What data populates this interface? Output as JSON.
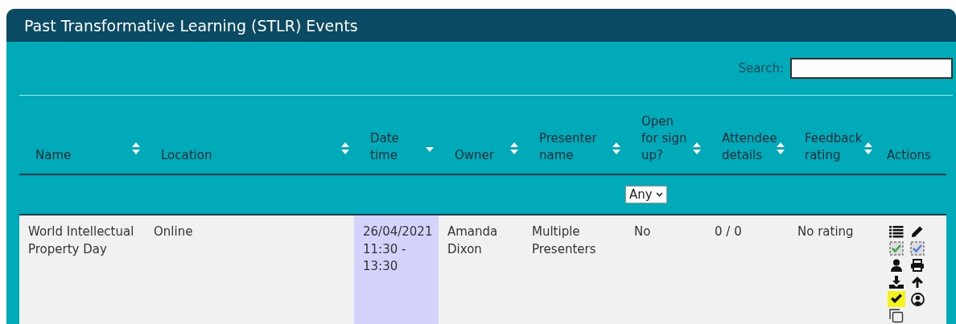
{
  "panel": {
    "title": "Past Transformative Learning (STLR) Events"
  },
  "search": {
    "label": "Search:"
  },
  "table": {
    "columns": [
      {
        "label": "Name",
        "sortable": true,
        "sorted_desc": false
      },
      {
        "label": "Location",
        "sortable": true,
        "sorted_desc": false
      },
      {
        "label": "Date time",
        "sortable": true,
        "sorted_desc": true
      },
      {
        "label": "Owner",
        "sortable": true,
        "sorted_desc": false
      },
      {
        "label": "Presenter name",
        "sortable": true,
        "sorted_desc": false
      },
      {
        "label": "Open for sign up?",
        "sortable": true,
        "sorted_desc": false,
        "filter": "Any"
      },
      {
        "label": "Attendee details",
        "sortable": true,
        "sorted_desc": false
      },
      {
        "label": "Feedback rating",
        "sortable": true,
        "sorted_desc": false
      },
      {
        "label": "Actions",
        "sortable": false,
        "sorted_desc": false
      }
    ],
    "rows": [
      {
        "cells": [
          "World Intellectual Property Day",
          "Online",
          "26/04/2021 11:30 - 13:30",
          "Amanda Dixon",
          "Multiple Presenters",
          "No",
          "0 / 0",
          "No rating"
        ],
        "actions": [
          {
            "kind": "list",
            "highlighted": false
          },
          {
            "kind": "pencil",
            "highlighted": false
          },
          {
            "kind": "check-green",
            "highlighted": false
          },
          {
            "kind": "check-blue",
            "highlighted": false
          },
          {
            "kind": "person",
            "highlighted": false
          },
          {
            "kind": "printer",
            "highlighted": false
          },
          {
            "kind": "download",
            "highlighted": false
          },
          {
            "kind": "arrow-up",
            "highlighted": false
          },
          {
            "kind": "check",
            "highlighted": true
          },
          {
            "kind": "user-circle",
            "highlighted": false
          },
          {
            "kind": "copy",
            "highlighted": false
          }
        ]
      }
    ]
  }
}
